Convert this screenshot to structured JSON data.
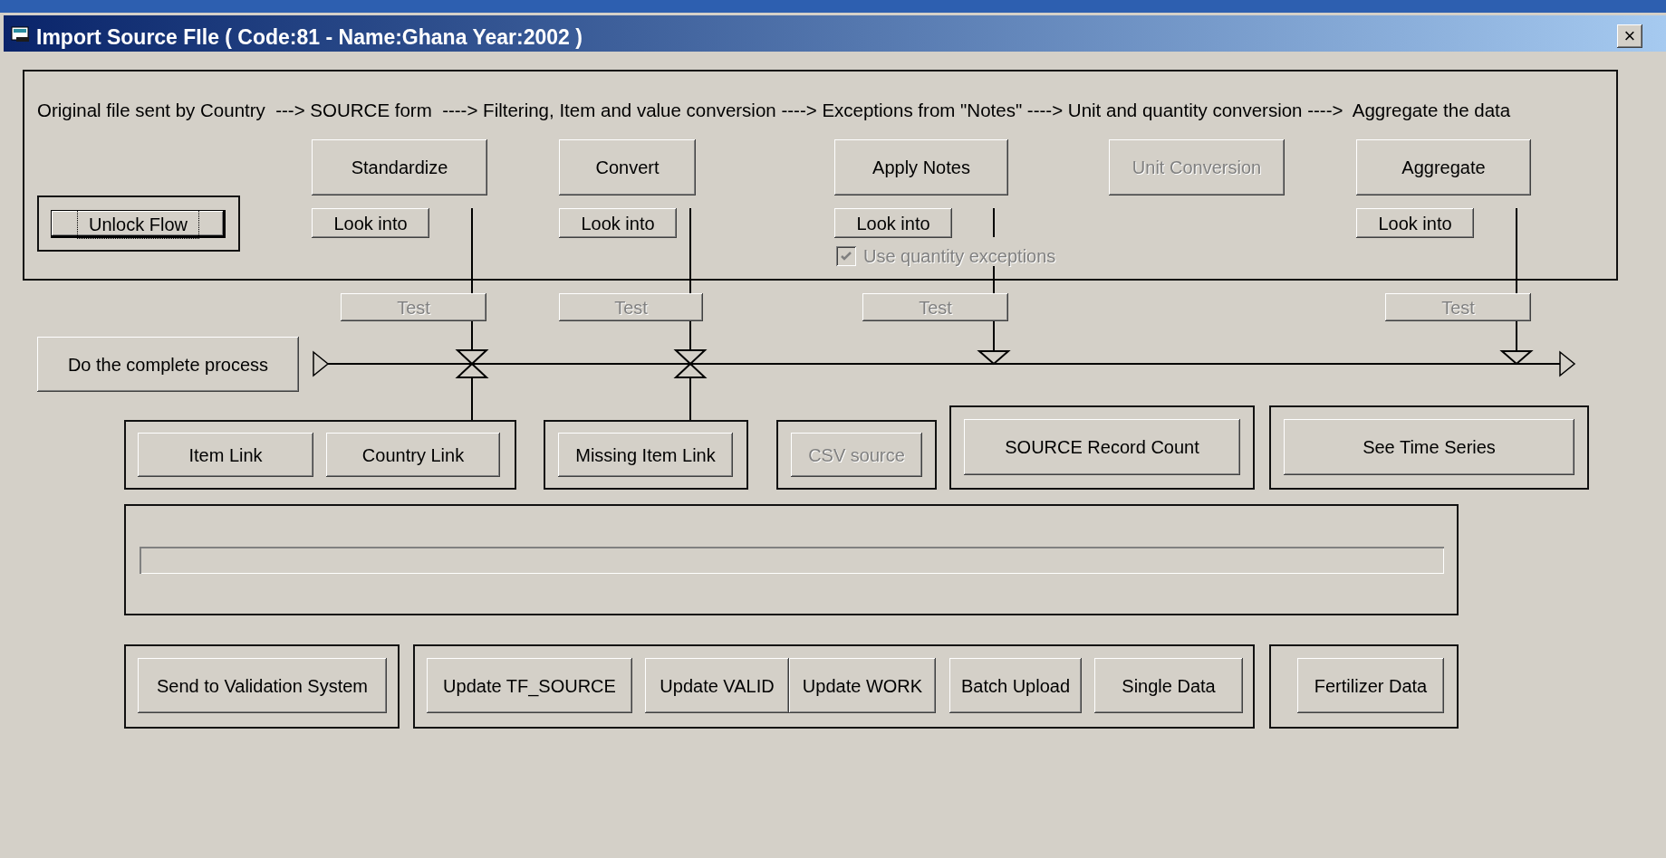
{
  "window": {
    "title": "Import Source FIle ( Code:81 - Name:Ghana Year:2002 )",
    "close": "×"
  },
  "flow_description": "Original file sent by Country  ---> SOURCE form  ----> Filtering, Item and value conversion ----> Exceptions from \"Notes\" ----> Unit and quantity conversion ---->  Aggregate the data",
  "unlock_button": {
    "label": "Unlock Flow",
    "focused": true
  },
  "steps": [
    {
      "label": "Standardize",
      "disabled": false,
      "look_into": "Look into",
      "test": "Test",
      "test_disabled": true,
      "kind": "valve"
    },
    {
      "label": "Convert",
      "disabled": false,
      "look_into": "Look into",
      "test": "Test",
      "test_disabled": true,
      "kind": "valve"
    },
    {
      "label": "Apply Notes",
      "disabled": false,
      "look_into": "Look into",
      "test": "Test",
      "test_disabled": true,
      "kind": "merge",
      "option": {
        "label": "Use quantity exceptions",
        "checked": true,
        "disabled": true
      }
    },
    {
      "label": "Unit Conversion",
      "disabled": true
    },
    {
      "label": "Aggregate",
      "disabled": false,
      "look_into": "Look into",
      "test": "Test",
      "test_disabled": true,
      "kind": "merge"
    }
  ],
  "process_button": "Do the complete process",
  "link_groups": [
    {
      "buttons": [
        {
          "label": "Item Link",
          "disabled": false
        },
        {
          "label": "Country Link",
          "disabled": false
        }
      ]
    },
    {
      "buttons": [
        {
          "label": "Missing Item Link",
          "disabled": false
        }
      ]
    },
    {
      "buttons": [
        {
          "label": "CSV source",
          "disabled": true
        }
      ]
    },
    {
      "buttons": [
        {
          "label": "SOURCE Record Count",
          "disabled": false
        }
      ]
    },
    {
      "buttons": [
        {
          "label": "See Time Series",
          "disabled": false
        }
      ]
    }
  ],
  "progress": {
    "level": 0
  },
  "action_groups": [
    {
      "buttons": [
        {
          "label": "Send to Validation System",
          "disabled": false
        }
      ]
    },
    {
      "buttons": [
        {
          "label": "Update TF_SOURCE",
          "disabled": false
        },
        {
          "label": "Update VALID",
          "disabled": false
        },
        {
          "label": "Update WORK",
          "disabled": false
        },
        {
          "label": "Batch Upload",
          "disabled": false
        },
        {
          "label": "Single Data",
          "disabled": false
        }
      ]
    },
    {
      "buttons": [
        {
          "label": "Fertilizer Data",
          "disabled": false
        }
      ]
    }
  ]
}
